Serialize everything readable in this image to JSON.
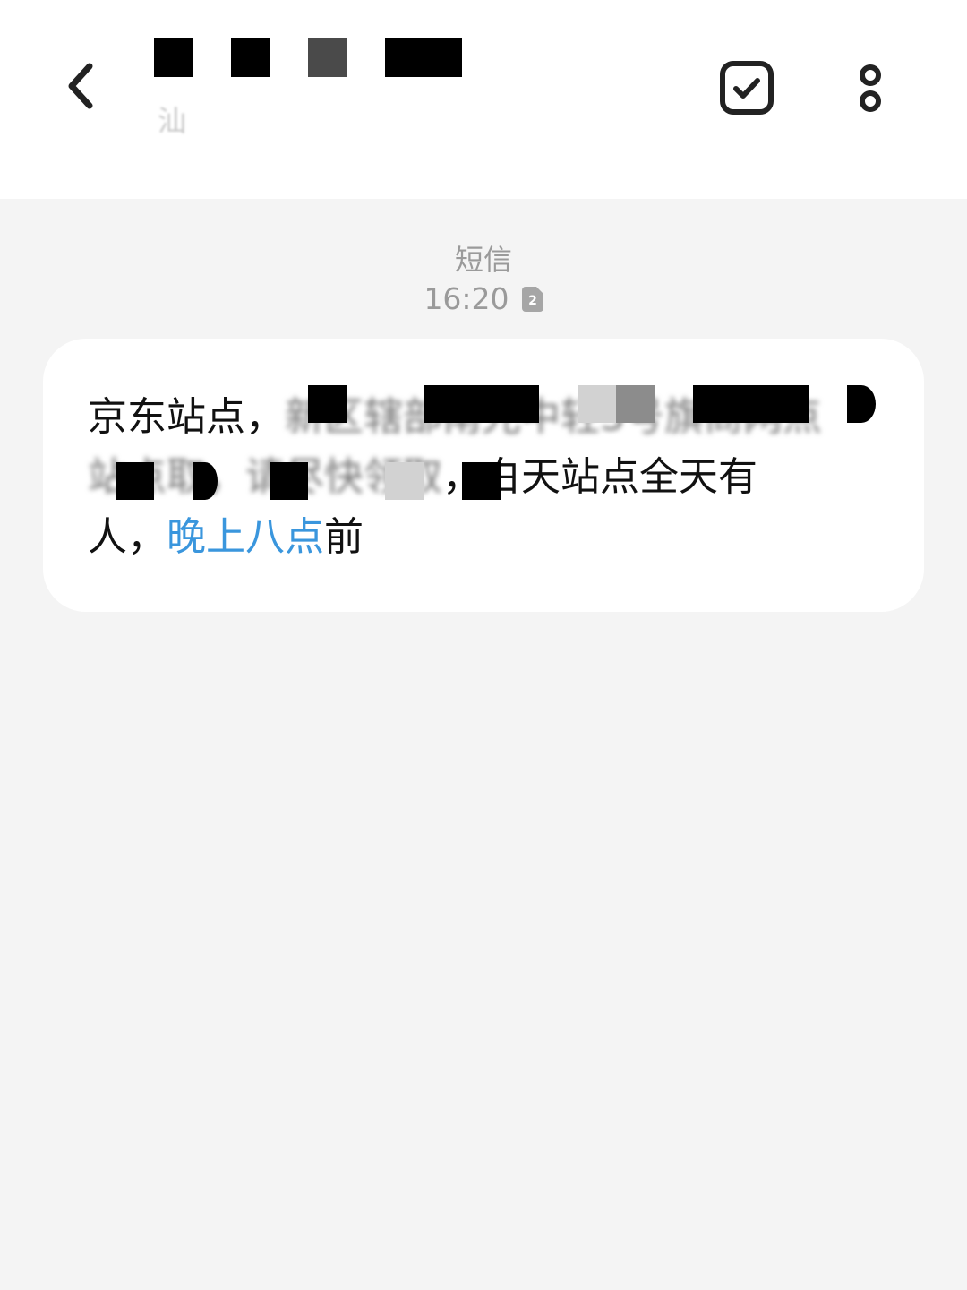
{
  "header": {
    "back_icon": "chevron-left-icon",
    "title": "",
    "subtitle_fragment": "汕",
    "actions": [
      {
        "name": "select-messages",
        "icon": "check-square-icon"
      },
      {
        "name": "more-options",
        "icon": "vertical-dots-icon"
      }
    ]
  },
  "conversation": {
    "channel_label": "短信",
    "time": "16:20",
    "sim_badge": "2",
    "message": {
      "line1_visible": "京东站点，",
      "line1_obscured": "新区辖部南光中轻3号旗商网点",
      "line2_obscured_a": "站点取",
      "line2_obscured_b": "，请尽快领取",
      "line2_visible": "，白天站点全天有",
      "line3_prefix": "人，",
      "line3_link": "晚上八点",
      "line3_suffix": "前"
    }
  },
  "colors": {
    "header_bg": "#ffffff",
    "page_bg": "#f4f4f4",
    "bubble_bg": "#ffffff",
    "link": "#3a96dd",
    "meta_text": "#9a9a9a"
  }
}
